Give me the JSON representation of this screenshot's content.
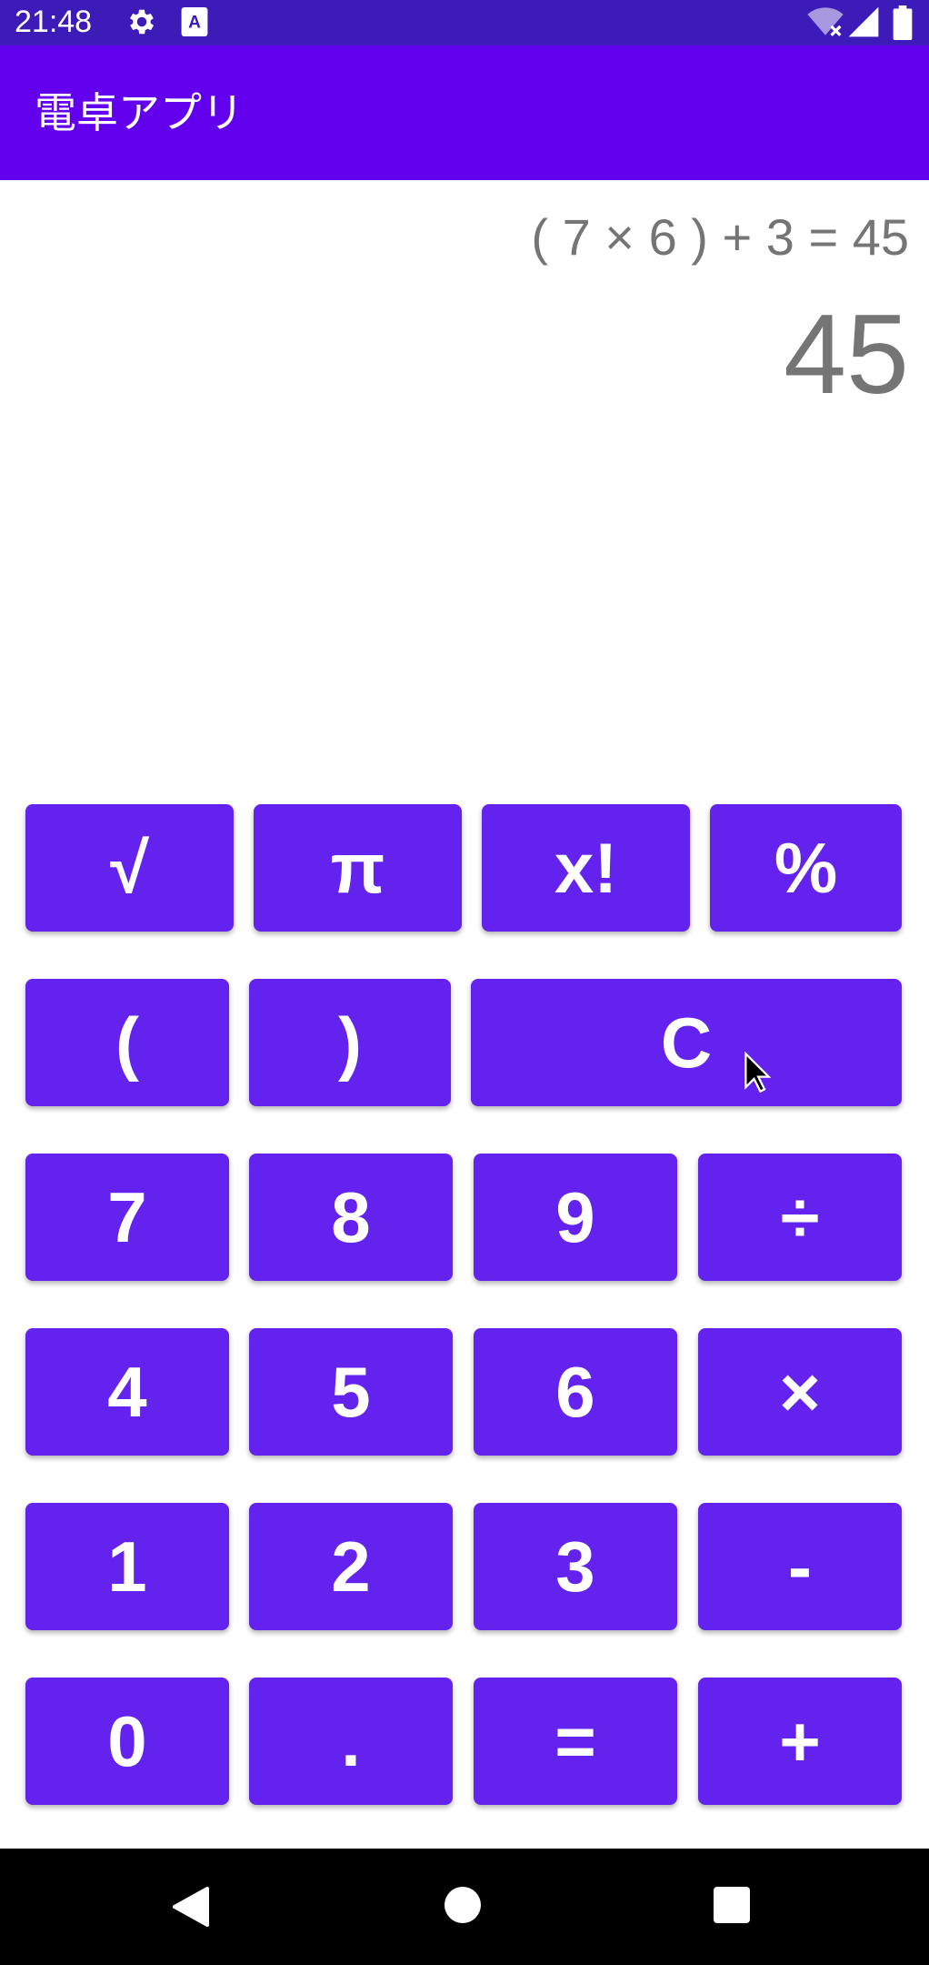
{
  "status_bar": {
    "time": "21:48",
    "icons": [
      "gear-icon",
      "keyboard-a-icon",
      "wifi-off-icon",
      "signal-icon",
      "battery-icon"
    ]
  },
  "app_bar": {
    "title": "電卓アプリ"
  },
  "display": {
    "expression": "( 7 × 6 ) + 3 = 45",
    "result": "45"
  },
  "keypad": {
    "sqrt": "√",
    "pi": "π",
    "factorial": "x!",
    "percent": "%",
    "open_paren": "(",
    "close_paren": ")",
    "clear": "C",
    "seven": "7",
    "eight": "8",
    "nine": "9",
    "divide": "÷",
    "four": "4",
    "five": "5",
    "six": "6",
    "multiply": "×",
    "one": "1",
    "two": "2",
    "three": "3",
    "minus": "-",
    "zero": "0",
    "dot": ".",
    "equals": "=",
    "plus": "+"
  },
  "colors": {
    "status_bar": "#3d1bb8",
    "app_bar": "#6200ee",
    "key": "#6322ee",
    "display_text": "#757575",
    "nav_bar": "#000000"
  },
  "nav_bar": {
    "icons": [
      "back-icon",
      "home-icon",
      "recents-icon"
    ]
  }
}
